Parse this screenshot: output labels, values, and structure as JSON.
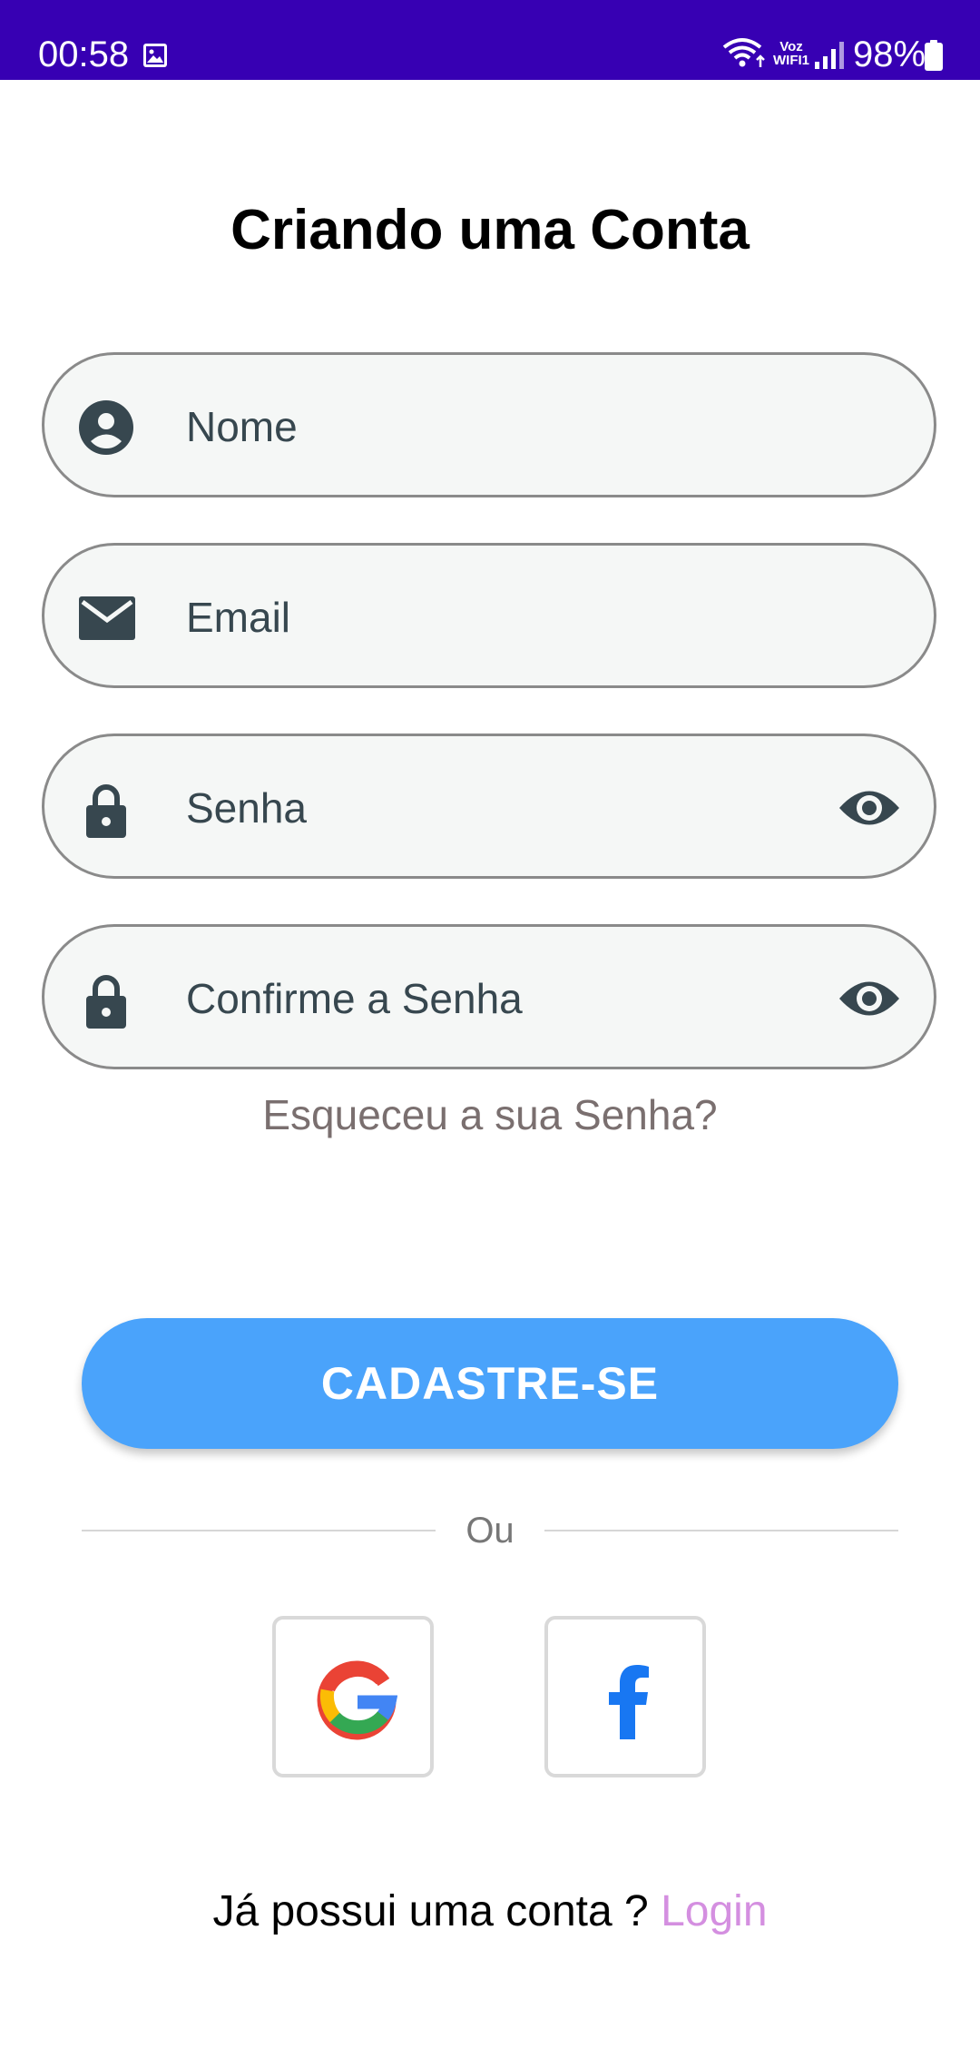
{
  "status_bar": {
    "time": "00:58",
    "voz_top": "Voz",
    "voz_bottom": "WIFI1",
    "battery": "98%",
    "background_color": "#3700B3"
  },
  "title": "Criando uma Conta",
  "fields": {
    "name": {
      "placeholder": "Nome",
      "icon": "account-circle-icon"
    },
    "email": {
      "placeholder": "Email",
      "icon": "mail-icon"
    },
    "password": {
      "placeholder": "Senha",
      "icon": "lock-icon",
      "trailing_icon": "eye-icon"
    },
    "confirm_password": {
      "placeholder": "Confirme a Senha",
      "icon": "lock-icon",
      "trailing_icon": "eye-icon"
    }
  },
  "forgot_password": "Esqueceu a sua Senha?",
  "signup_button": "CADASTRE-SE",
  "divider_text": "Ou",
  "social": {
    "google_icon": "google-icon",
    "facebook_icon": "facebook-icon"
  },
  "footer": {
    "question": "Já possui uma conta ? ",
    "login_link": "Login"
  },
  "colors": {
    "primary_button": "#4AA3FB",
    "icon": "#37474F",
    "field_background": "#f5f7f6",
    "field_border": "#8a8a8a",
    "link": "#D48FE0",
    "forgot_text": "#7a6f6f"
  }
}
